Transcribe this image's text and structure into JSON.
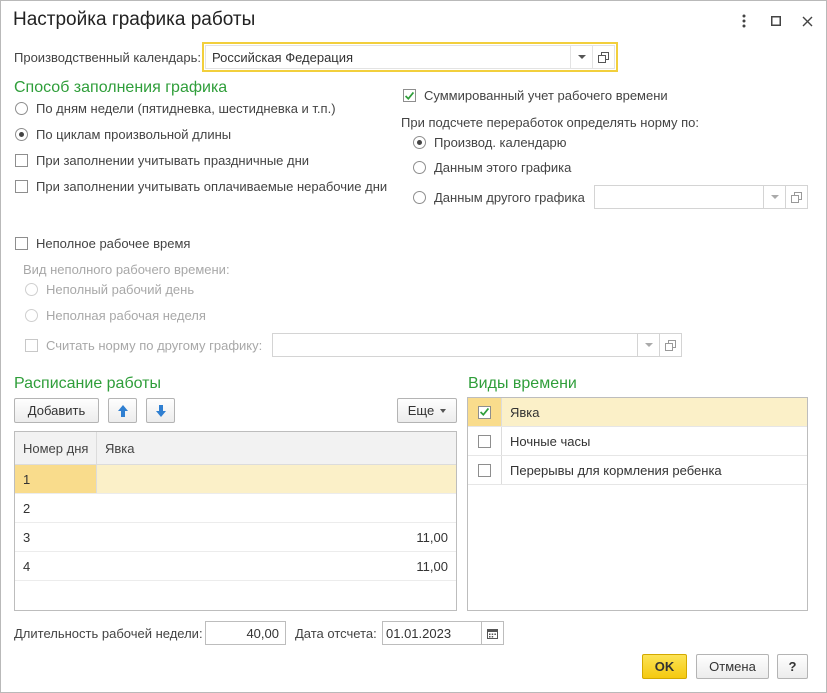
{
  "window": {
    "title": "Настройка графика работы",
    "menu_icon": "more-vertical-icon",
    "maximize_icon": "maximize-icon",
    "close_icon": "close-icon"
  },
  "calendar": {
    "label": "Производственный календарь:",
    "value": "Российская Федерация"
  },
  "fill_method": {
    "heading": "Способ заполнения графика",
    "options": [
      {
        "label": "По дням недели (пятидневка, шестидневка и т.п.)",
        "selected": false
      },
      {
        "label": "По циклам произвольной длины",
        "selected": true
      }
    ],
    "holidays_label": "При заполнении учитывать праздничные дни",
    "holidays_checked": false,
    "paid_nonwork_label": "При заполнении учитывать оплачиваемые нерабочие дни",
    "paid_nonwork_checked": false
  },
  "summary": {
    "label": "Суммированный учет рабочего времени",
    "checked": true,
    "norm_heading": "При подсчете переработок определять норму по:",
    "options": [
      {
        "label": "Производ. календарю",
        "selected": true
      },
      {
        "label": "Данным этого графика",
        "selected": false
      },
      {
        "label": "Данным другого графика",
        "selected": false
      }
    ],
    "other_schedule_value": ""
  },
  "part_time": {
    "label": "Неполное рабочее время",
    "checked": false,
    "kind_label": "Вид неполного рабочего времени:",
    "options": [
      {
        "label": "Неполный рабочий день"
      },
      {
        "label": "Неполная рабочая неделя"
      }
    ],
    "norm_other_label": "Считать норму по другому графику:",
    "norm_other_value": ""
  },
  "schedule": {
    "heading": "Расписание работы",
    "add_label": "Добавить",
    "up_icon": "arrow-up-icon",
    "down_icon": "arrow-down-icon",
    "more_label": "Еще",
    "columns": [
      "Номер дня",
      "Явка"
    ],
    "rows": [
      {
        "day": "1",
        "value": ""
      },
      {
        "day": "2",
        "value": ""
      },
      {
        "day": "3",
        "value": "11,00"
      },
      {
        "day": "4",
        "value": "11,00"
      }
    ]
  },
  "time_kinds": {
    "heading": "Виды времени",
    "items": [
      {
        "label": "Явка",
        "checked": true
      },
      {
        "label": "Ночные часы",
        "checked": false
      },
      {
        "label": "Перерывы для кормления ребенка",
        "checked": false
      }
    ]
  },
  "footer": {
    "week_length_label": "Длительность рабочей недели:",
    "week_length_value": "40,00",
    "ref_date_label": "Дата отсчета:",
    "ref_date_value": "01.01.2023",
    "calendar_icon": "calendar-icon",
    "ok_label": "OK",
    "cancel_label": "Отмена",
    "help_label": "?"
  },
  "colors": {
    "accent_green": "#2f9e3a",
    "highlight_yellow": "#f5c90f",
    "selection_row": "#fbf0c8"
  }
}
